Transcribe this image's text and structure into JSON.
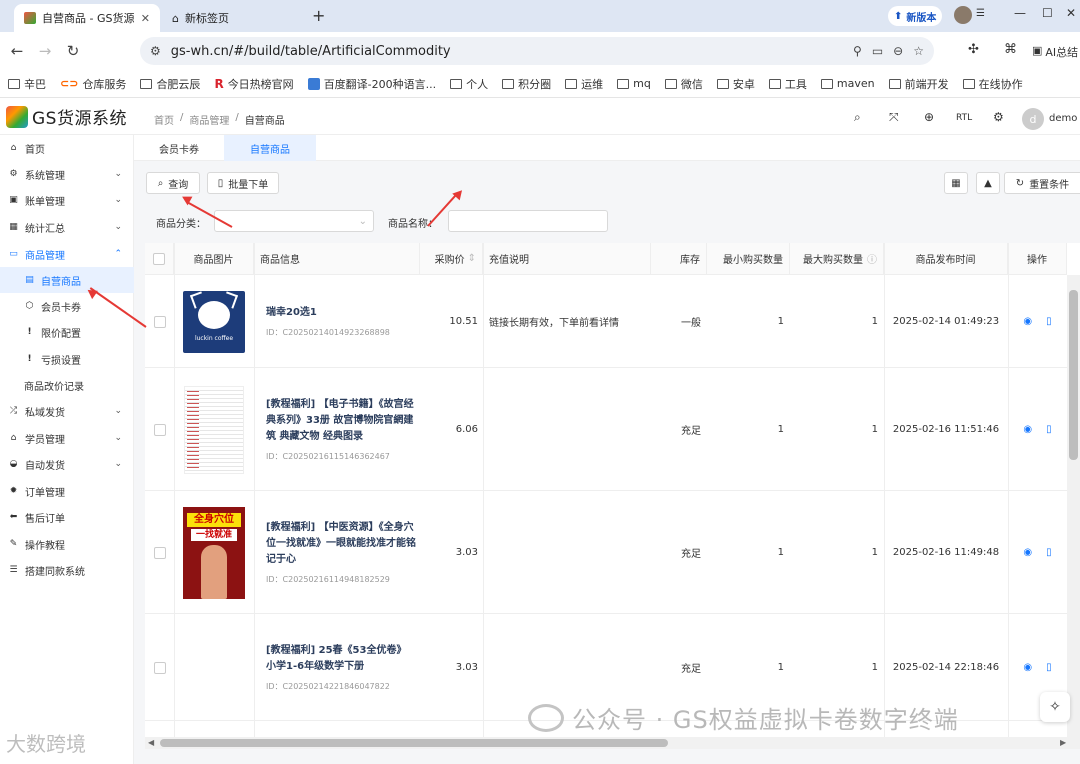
{
  "browser": {
    "tabs": [
      {
        "title": "自营商品 - GS货源"
      },
      {
        "title": "新标签页"
      }
    ],
    "new_version": "新版本",
    "url": "gs-wh.cn/#/build/table/ArtificialCommodity",
    "ai_label": "AI总结",
    "bookmarks": [
      "辛巴",
      "仓库服务",
      "合肥云辰",
      "今日热榜官网",
      "百度翻译-200种语言...",
      "个人",
      "积分圈",
      "运维",
      "mq",
      "微信",
      "安卓",
      "工具",
      "maven",
      "前端开发",
      "在线协作"
    ]
  },
  "app": {
    "logo_text": "GS货源系统",
    "breadcrumb": [
      "首页",
      "商品管理",
      "自营商品"
    ],
    "rtl_label": "RTL",
    "avatar_letter": "d",
    "username": "demo"
  },
  "sidebar": {
    "items": [
      {
        "label": "首页"
      },
      {
        "label": "系统管理"
      },
      {
        "label": "账单管理"
      },
      {
        "label": "统计汇总"
      },
      {
        "label": "商品管理"
      },
      {
        "label": "自营商品"
      },
      {
        "label": "会员卡券"
      },
      {
        "label": "限价配置"
      },
      {
        "label": "亏损设置"
      },
      {
        "label": "商品改价记录"
      },
      {
        "label": "私域发货"
      },
      {
        "label": "学员管理"
      },
      {
        "label": "自动发货"
      },
      {
        "label": "订单管理"
      },
      {
        "label": "售后订单"
      },
      {
        "label": "操作教程"
      },
      {
        "label": "搭建同款系统"
      }
    ]
  },
  "page_tabs": [
    "会员卡券",
    "自营商品"
  ],
  "toolbar": {
    "query": "查询",
    "batch_order": "批量下单",
    "reset": "重置条件"
  },
  "filters": {
    "category_label": "商品分类：",
    "name_label": "商品名称："
  },
  "table": {
    "columns": [
      "商品图片",
      "商品信息",
      "采购价",
      "充值说明",
      "库存",
      "最小购买数量",
      "最大购买数量",
      "商品发布时间",
      "操作"
    ],
    "rows": [
      {
        "image": "luckin coffee",
        "name": "瑞幸20选1",
        "id": "ID：C2025021401492326889​8",
        "price": "10.51",
        "note": "链接长期有效，下单前看详情",
        "stock": "一般",
        "min": "1",
        "max": "1",
        "time": "2025-02-14 01:49:23"
      },
      {
        "image": "",
        "name": "[教程福利] 【电子书籍】《故宫经典系列》33册 故宫博物院官網建筑 典藏文物 经典图录",
        "id": "ID：C20250216115146362467",
        "price": "6.06",
        "note": "",
        "stock": "充足",
        "min": "1",
        "max": "1",
        "time": "2025-02-16 11:51:46"
      },
      {
        "image": "",
        "name": "[教程福利] 【中医资源】《全身穴位一找就准》一眼就能找准才能铭记于心",
        "id": "ID：C20250216114948182529",
        "price": "3.03",
        "note": "",
        "stock": "充足",
        "min": "1",
        "max": "1",
        "time": "2025-02-16 11:49:48"
      },
      {
        "image": "",
        "name": "[教程福利] 25春《53全优卷》小学1-6年级数学下册",
        "id": "ID：C20250214221846047822",
        "price": "3.03",
        "note": "",
        "stock": "充足",
        "min": "1",
        "max": "1",
        "time": "2025-02-14 22:18:46"
      }
    ]
  },
  "images": {
    "acu_title1": "全身穴位",
    "acu_title2": "一找就准",
    "luckin_text": "luckin coffee"
  },
  "watermark": {
    "main": "公众号 · GS权益虚拟卡卷数字终端",
    "corner": "大数跨境"
  }
}
